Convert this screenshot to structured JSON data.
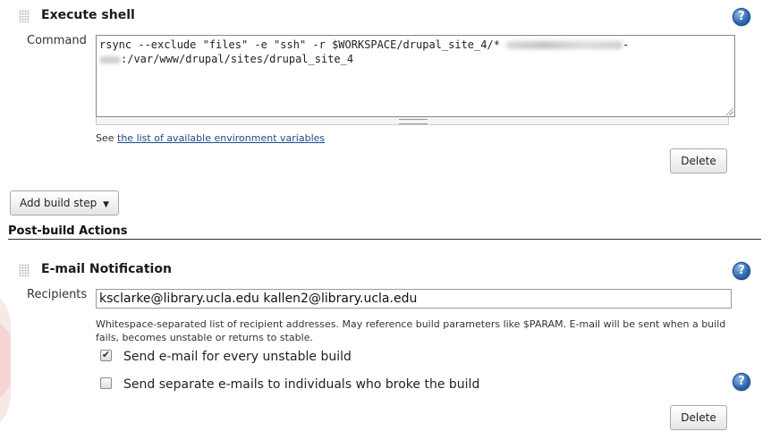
{
  "execute_shell": {
    "title": "Execute shell",
    "command_label": "Command",
    "command_line1": "rsync --exclude \"files\" -e \"ssh\" -r $WORKSPACE/drupal_site_4/* ",
    "command_line1_tail": "-",
    "command_line2": ":/var/www/drupal/sites/drupal_site_4",
    "env_prefix": "See ",
    "env_link": "the list of available environment variables",
    "delete_label": "Delete",
    "help_icon": "help-icon"
  },
  "add_build_step": {
    "label": "Add build step",
    "arrow": "▼"
  },
  "post_build": {
    "title": "Post-build Actions"
  },
  "email_notification": {
    "title": "E-mail Notification",
    "recipients_label": "Recipients",
    "recipients_value": "ksclarke@library.ucla.edu kallen2@library.ucla.edu",
    "recipients_help": "Whitespace-separated list of recipient addresses. May reference build parameters like $PARAM. E-mail will be sent when a build fails, becomes unstable or returns to stable.",
    "unstable_label": "Send e-mail for every unstable build",
    "unstable_checked": true,
    "individuals_label": "Send separate e-mails to individuals who broke the build",
    "individuals_checked": false,
    "delete_label": "Delete",
    "check_mark": "✔",
    "help_icon": "help-icon"
  },
  "help_glyph": "?"
}
